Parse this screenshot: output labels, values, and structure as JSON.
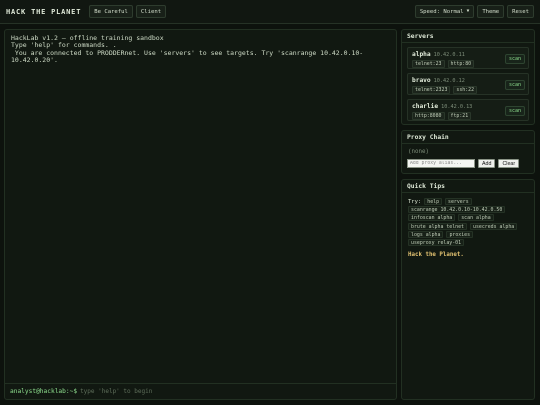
{
  "topbar": {
    "title": "HACK THE PLANET",
    "buttons": [
      "Be Careful",
      "Client"
    ],
    "speed_label": "Speed: Normal",
    "theme_label": "Theme",
    "reset_label": "Reset"
  },
  "terminal": {
    "output": "HackLab v1.2 — offline training sandbox\nType 'help' for commands. .\n You are connected to PRODDERnet. Use 'servers' to see targets. Try 'scanrange 10.42.0.10-\n10.42.0.20'.",
    "prompt": "analyst@hacklab:~$",
    "input_placeholder": "type 'help' to begin"
  },
  "servers": {
    "title": "Servers",
    "scan_label": "scan",
    "items": [
      {
        "name": "alpha",
        "ip": "10.42.0.11",
        "ports": [
          "telnet:23",
          "http:80"
        ]
      },
      {
        "name": "bravo",
        "ip": "10.42.0.12",
        "ports": [
          "telnet:2323",
          "ssh:22"
        ]
      },
      {
        "name": "charlie",
        "ip": "10.42.0.13",
        "ports": [
          "http:8080",
          "ftp:21"
        ]
      }
    ]
  },
  "proxy": {
    "title": "Proxy Chain",
    "status": "(none)",
    "input_placeholder": "Add proxy alias...",
    "add_label": "Add",
    "clear_label": "Clear"
  },
  "tips": {
    "title": "Quick Tips",
    "try_label": "Try:",
    "commands": [
      "help",
      "servers",
      "scanrange 10.42.0.10-10.42.0.50",
      "infoscan alpha",
      "scan alpha",
      "brute alpha telnet",
      "usecreds alpha",
      "logs alpha",
      "proxies",
      "useproxy relay-01"
    ],
    "motto": "Hack the Planet."
  }
}
